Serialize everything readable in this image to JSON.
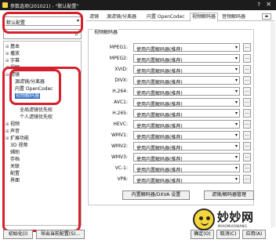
{
  "window": {
    "title": "参数选项(201021) - \"默认配置\"",
    "help_label": "?",
    "close_label": "✕"
  },
  "left": {
    "preset_value": "默认配置",
    "filter_value": "",
    "tree": [
      {
        "label": "基本",
        "expander": "⊞"
      },
      {
        "label": "播放",
        "expander": "⊞"
      },
      {
        "label": "字幕",
        "expander": "⊞"
      },
      {
        "label": "视频",
        "expander": "⊞"
      },
      {
        "label": "滤镜",
        "expander": "⊟"
      },
      {
        "label": "源滤镜/分离器",
        "expander": ""
      },
      {
        "label": "内置 OpenCodec",
        "expander": ""
      },
      {
        "label": "视频解码器",
        "expander": ""
      },
      {
        "label": "",
        "expander": ""
      },
      {
        "label": "全局滤镜优先权",
        "expander": ""
      },
      {
        "label": "个人滤镜优先权",
        "expander": ""
      },
      {
        "label": "视频",
        "expander": "⊞"
      },
      {
        "label": "声音",
        "expander": "⊞"
      },
      {
        "label": "扩展功能",
        "expander": "⊞"
      },
      {
        "label": "3D 视频",
        "expander": ""
      },
      {
        "label": "辅助",
        "expander": ""
      },
      {
        "label": "存档",
        "expander": ""
      },
      {
        "label": "关联",
        "expander": ""
      },
      {
        "label": "配置",
        "expander": ""
      },
      {
        "label": "界面",
        "expander": ""
      }
    ]
  },
  "tabs": [
    "滤镜",
    "源滤镜/分离器",
    "内置 OpenCodec",
    "视频解码器",
    "音频解码器"
  ],
  "tab_scroll_label": "◂▸",
  "group_title": "视频解码器",
  "decoders": [
    {
      "label": "MPEG1:",
      "value": "使用内置解码器(推荐)"
    },
    {
      "label": "MPEG2:",
      "value": "使用内置解码器(推荐)"
    },
    {
      "label": "XVID:",
      "value": "使用内置解码器(推荐)"
    },
    {
      "label": "DIVX:",
      "value": "使用内置解码器(推荐)"
    },
    {
      "label": "H.264:",
      "value": "使用内置解码器(推荐)"
    },
    {
      "label": "AVC1:",
      "value": "使用内置解码器(推荐)"
    },
    {
      "label": "H.265:",
      "value": "使用内置解码器(推荐)"
    },
    {
      "label": "HEVC:",
      "value": "使用内置解码器(推荐)"
    },
    {
      "label": "WMV1:",
      "value": "使用内置解码器(推荐)"
    },
    {
      "label": "WMV2:",
      "value": "使用内置解码器(推荐)"
    },
    {
      "label": "WMV3:",
      "value": "使用内置解码器(推荐)"
    },
    {
      "label": "VC-1:",
      "value": "使用内置解码器(推荐)"
    },
    {
      "label": "VP8:",
      "value": "使用内置解码器(推荐)"
    }
  ],
  "more_label": "...",
  "buttons": {
    "dxva": "内置解码器/DXVA 设置",
    "manager": "滤镜/解码器管理",
    "init": "初始化(I)",
    "export": "导出当前配置(S)...",
    "ok": "确定(O)",
    "cancel": "取消(C)",
    "apply": "应用(A)"
  },
  "watermark": {
    "brand": "妙妙网",
    "brand_en": "MIAOMIAOWANG"
  },
  "colors": {
    "highlight": "#d5212e",
    "selection": "#2f6cc4",
    "titlebar": "#1c1c1c"
  }
}
